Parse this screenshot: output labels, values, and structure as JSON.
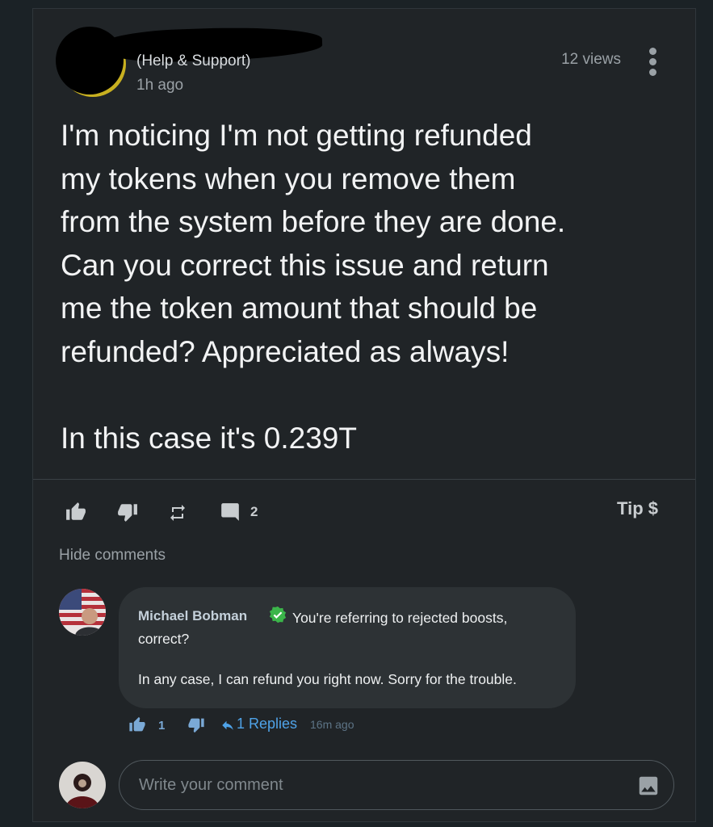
{
  "post": {
    "category": "(Help & Support)",
    "time_ago": "1h ago",
    "views": "12 views",
    "body": "I'm noticing I'm not getting refunded\nmy tokens when you remove them\nfrom the system before they are done.\nCan you correct this issue and return\nme the token amount that should be\nrefunded? Appreciated as always!\n\nIn this case it's 0.239T",
    "comment_count": "2",
    "tip_label": "Tip $"
  },
  "comments_section": {
    "hide_label": "Hide comments",
    "comment": {
      "author": "Michael Bobman",
      "text_line1": "You're referring to rejected boosts, correct?",
      "text_line2": "In any case, I can refund you right now. Sorry for the trouble.",
      "like_count": "1",
      "replies_label": "1 Replies",
      "time": "16m ago"
    },
    "input_placeholder": "Write your comment"
  },
  "colors": {
    "background": "#1b2226",
    "card": "#202427",
    "bubble": "#2d3235",
    "link": "#4fa3e8",
    "verified": "#3bb54a"
  },
  "icons": [
    "thumbs-up-icon",
    "thumbs-down-icon",
    "repost-icon",
    "comment-icon",
    "more-vertical-icon",
    "verified-icon",
    "reply-icon",
    "image-icon"
  ]
}
